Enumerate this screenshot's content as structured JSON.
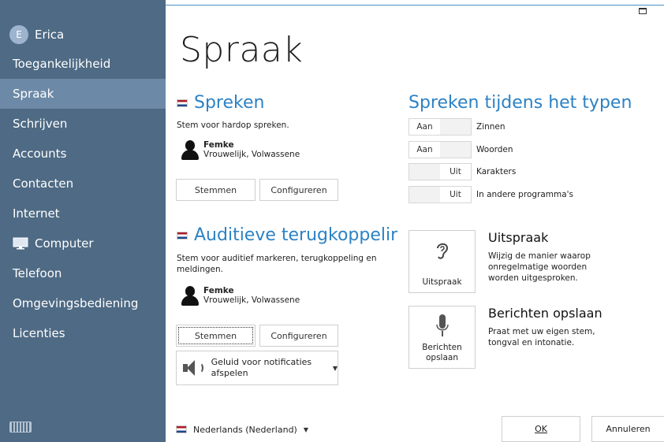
{
  "sidebar": {
    "user": {
      "initial": "E",
      "name": "Erica"
    },
    "items": [
      {
        "label": "Toegankelijkheid"
      },
      {
        "label": "Spraak"
      },
      {
        "label": "Schrijven"
      },
      {
        "label": "Accounts"
      },
      {
        "label": "Contacten"
      },
      {
        "label": "Internet"
      },
      {
        "label": "Computer"
      },
      {
        "label": "Telefoon"
      },
      {
        "label": "Omgevingsbediening"
      },
      {
        "label": "Licenties"
      }
    ],
    "active": "Spraak"
  },
  "page": {
    "title": "Spraak"
  },
  "spreken": {
    "title": "Spreken",
    "desc": "Stem voor hardop spreken.",
    "voice_name": "Femke",
    "voice_desc": "Vrouwelijk, Volwassene",
    "voices_button": "Stemmen",
    "configure_button": "Configureren"
  },
  "auditief": {
    "title": "Auditieve terugkoppelir",
    "desc": "Stem voor auditief markeren, terugkoppeling en meldingen.",
    "voice_name": "Femke",
    "voice_desc": "Vrouwelijk, Volwassene",
    "voices_button": "Stemmen",
    "configure_button": "Configureren",
    "notify_select": "Geluid voor notificaties afspelen"
  },
  "typing": {
    "title": "Spreken tijdens het typen",
    "rows": [
      {
        "on": "Aan",
        "off": "",
        "label": "Zinnen",
        "state": "on"
      },
      {
        "on": "Aan",
        "off": "",
        "label": "Woorden",
        "state": "on"
      },
      {
        "on": "",
        "off": "Uit",
        "label": "Karakters",
        "state": "off"
      },
      {
        "on": "",
        "off": "Uit",
        "label": "In andere programma's",
        "state": "off"
      }
    ]
  },
  "tiles": {
    "pronunciation": {
      "label": "Uitspraak",
      "title": "Uitspraak",
      "desc": "Wijzig de manier waarop onregelmatige woorden worden uitgesproken."
    },
    "messages": {
      "label_line1": "Berichten",
      "label_line2": "opslaan",
      "title": "Berichten opslaan",
      "desc": "Praat met uw eigen stem, tongval en intonatie."
    }
  },
  "footer": {
    "language": "Nederlands (Nederland)",
    "ok": "OK",
    "cancel": "Annuleren"
  },
  "colors": {
    "sidebar": "#4e6a84",
    "sidebar_active": "#6c8aa7",
    "accent": "#2d82c4"
  }
}
